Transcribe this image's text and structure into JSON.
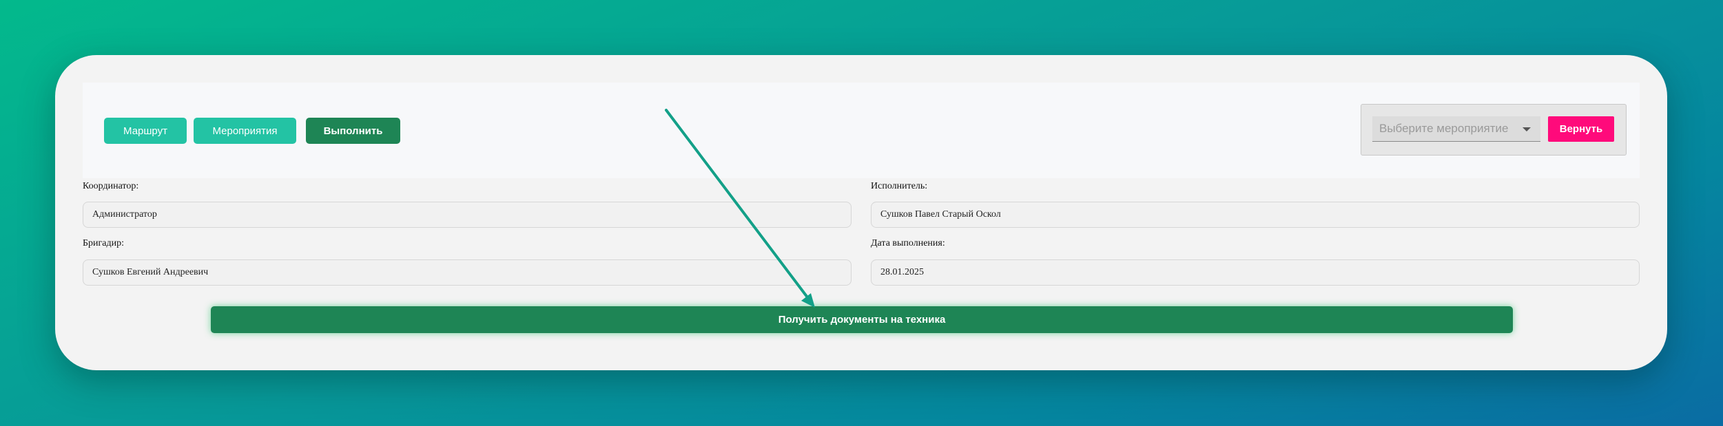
{
  "toolbar": {
    "route_label": "Маршрут",
    "events_label": "Мероприятия",
    "execute_label": "Выполнить"
  },
  "event_selector": {
    "placeholder": "Выберите мероприятие",
    "return_label": "Вернуть"
  },
  "form": {
    "coordinator": {
      "label": "Координатор:",
      "value": "Администратор"
    },
    "executor": {
      "label": "Исполнитель:",
      "value": "Сушков Павел Старый Оскол"
    },
    "foreman": {
      "label": "Бригадир:",
      "value": "Сушков Евгений Андреевич"
    },
    "date": {
      "label": "Дата выполнения:",
      "value": "28.01.2025"
    }
  },
  "actions": {
    "get_documents_label": "Получить документы на техника"
  },
  "colors": {
    "teal_button": "#23c3a4",
    "green_button": "#1e8555",
    "return_button": "#ff0a7b",
    "annotation_arrow": "#13a088"
  }
}
